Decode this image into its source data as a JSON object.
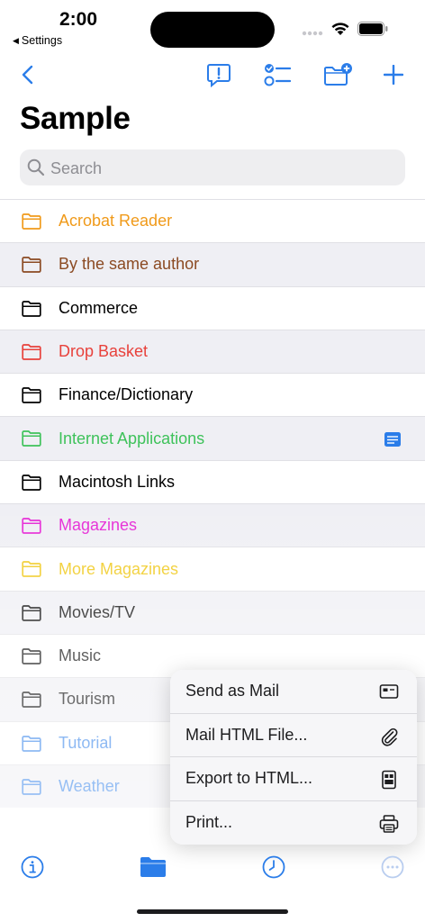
{
  "status_bar": {
    "time": "2:00",
    "back_label": "Settings"
  },
  "title": "Sample",
  "search": {
    "placeholder": "Search"
  },
  "accent": "#2b7de9",
  "folders": [
    {
      "label": "Acrobat Reader",
      "color": "#f09a1a"
    },
    {
      "label": "By the same author",
      "color": "#8b4a22"
    },
    {
      "label": "Commerce",
      "color": "#000000"
    },
    {
      "label": "Drop Basket",
      "color": "#e8413b"
    },
    {
      "label": "Finance/Dictionary",
      "color": "#000000"
    },
    {
      "label": "Internet Applications",
      "color": "#3ec25a",
      "note_icon": "note-icon"
    },
    {
      "label": "Macintosh Links",
      "color": "#000000"
    },
    {
      "label": "Magazines",
      "color": "#e62ad6"
    },
    {
      "label": "More Magazines",
      "color": "#f0c91b"
    },
    {
      "label": "Movies/TV",
      "color": "#000000"
    },
    {
      "label": "Music",
      "color": "#000000"
    },
    {
      "label": "Tourism",
      "color": "#000000"
    },
    {
      "label": "Tutorial",
      "color": "#2b7de9"
    },
    {
      "label": "Weather",
      "color": "#2b7de9"
    }
  ],
  "menu": [
    {
      "label": "Send as Mail",
      "icon": "mail-card-icon"
    },
    {
      "label": "Mail HTML File...",
      "icon": "paperclip-icon"
    },
    {
      "label": "Export to HTML...",
      "icon": "html-doc-icon"
    },
    {
      "label": "Print...",
      "icon": "printer-icon"
    }
  ]
}
